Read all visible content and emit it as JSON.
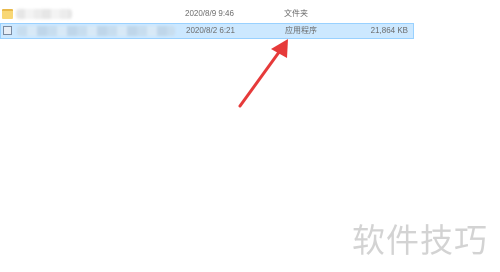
{
  "file_list": {
    "rows": [
      {
        "icon": "folder-icon",
        "modified": "2020/8/9 9:46",
        "type": "文件夹",
        "size": "",
        "selected": false
      },
      {
        "icon": "application-icon",
        "modified": "2020/8/2 6:21",
        "type": "应用程序",
        "size": "21,864 KB",
        "selected": true
      }
    ]
  },
  "annotation": {
    "arrow_color": "#e63a3a"
  },
  "watermark": {
    "text": "软件技巧"
  },
  "colors": {
    "selection_fill": "#cce8ff",
    "selection_border": "#99d1ff",
    "text": "#6b6b6b"
  }
}
